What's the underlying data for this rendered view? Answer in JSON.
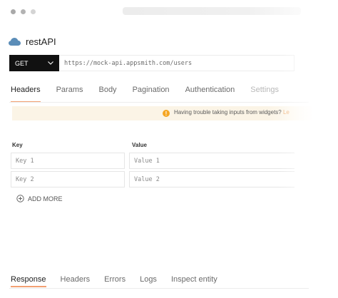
{
  "api": {
    "name": "restAPI",
    "icon": "cloud-icon"
  },
  "request": {
    "method": "GET",
    "url": "https://mock-api.appsmith.com/users"
  },
  "tabs": [
    {
      "label": "Headers",
      "active": true
    },
    {
      "label": "Params"
    },
    {
      "label": "Body"
    },
    {
      "label": "Pagination"
    },
    {
      "label": "Authentication"
    },
    {
      "label": "Settings"
    }
  ],
  "banner": {
    "text": "Having trouble taking inputs from widgets?",
    "link": "Le",
    "icon": "warning-icon"
  },
  "table": {
    "key_header": "Key",
    "value_header": "Value",
    "rows": [
      {
        "key": "Key 1",
        "value": "Value 1"
      },
      {
        "key": "Key 2",
        "value": "Value 2"
      }
    ],
    "add_more": "ADD MORE"
  },
  "bottom_tabs": [
    {
      "label": "Response",
      "active": true
    },
    {
      "label": "Headers"
    },
    {
      "label": "Errors"
    },
    {
      "label": "Logs"
    },
    {
      "label": "Inspect entity"
    }
  ],
  "colors": {
    "accent": "#f3a173",
    "method_bg": "#111111",
    "banner_bg": "#fbf4e6",
    "warning": "#f5a623",
    "cloud": "#5b8db8"
  }
}
